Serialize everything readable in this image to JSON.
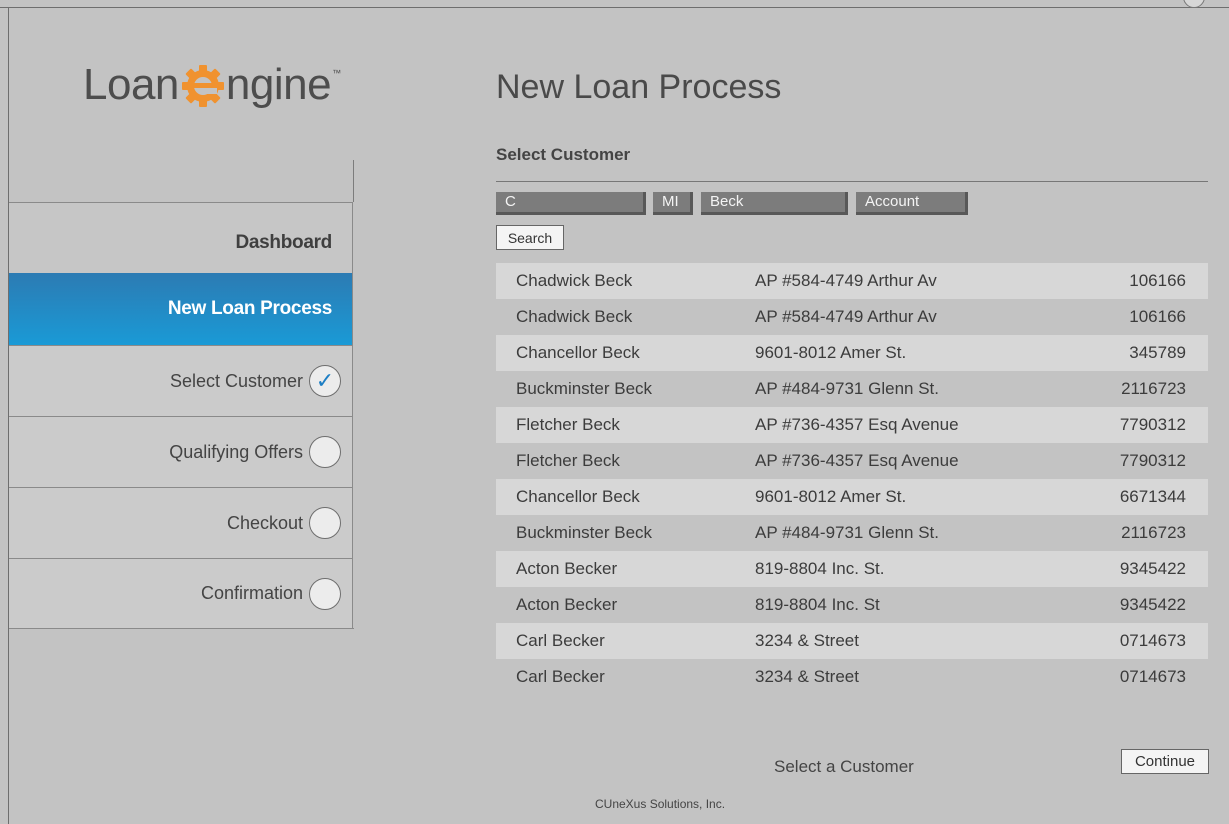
{
  "brand": {
    "logo_left": "Loan",
    "logo_right": "ngine",
    "logo_tm": "™",
    "gear_color": "#f0922f"
  },
  "page": {
    "title": "New Loan Process",
    "section": "Select Customer"
  },
  "sidebar": {
    "dashboard": "Dashboard",
    "active": "New Loan Process",
    "steps": [
      {
        "label": "Select Customer",
        "done": true
      },
      {
        "label": "Qualifying Offers",
        "done": false
      },
      {
        "label": "Checkout",
        "done": false
      },
      {
        "label": "Confirmation",
        "done": false
      }
    ],
    "check_glyph": "✓"
  },
  "search": {
    "first": "C",
    "mi": "MI",
    "last": "Beck",
    "account": "Account",
    "button": "Search"
  },
  "customers": [
    {
      "name": "Chadwick  Beck",
      "address": "AP #584-4749 Arthur Av",
      "account": "106166"
    },
    {
      "name": "Chadwick  Beck",
      "address": "AP #584-4749 Arthur Av",
      "account": "106166"
    },
    {
      "name": "Chancellor  Beck",
      "address": "9601-8012 Amer St.",
      "account": "345789"
    },
    {
      "name": "Buckminster  Beck",
      "address": "AP #484-9731 Glenn St.",
      "account": "2116723"
    },
    {
      "name": "Fletcher  Beck",
      "address": "AP #736-4357 Esq Avenue",
      "account": "7790312"
    },
    {
      "name": "Fletcher  Beck",
      "address": "AP #736-4357 Esq Avenue",
      "account": "7790312"
    },
    {
      "name": "Chancellor  Beck",
      "address": "9601-8012 Amer St.",
      "account": "6671344"
    },
    {
      "name": "Buckminster  Beck",
      "address": "AP #484-9731 Glenn St.",
      "account": "2116723"
    },
    {
      "name": "Acton  Becker",
      "address": "819-8804 Inc. St.",
      "account": "9345422"
    },
    {
      "name": "Acton  Becker",
      "address": "819-8804 Inc. St",
      "account": "9345422"
    },
    {
      "name": "Carl  Becker",
      "address": "3234 & Street",
      "account": "0714673"
    },
    {
      "name": "Carl  Becker",
      "address": "3234 & Street",
      "account": "0714673"
    }
  ],
  "actions": {
    "hint": "Select a Customer",
    "continue": "Continue"
  },
  "footer": "CUneXus Solutions, Inc.",
  "colors": {
    "active_nav": "#1a8fce",
    "background": "#c3c3c3",
    "field": "#7c7c7c"
  }
}
